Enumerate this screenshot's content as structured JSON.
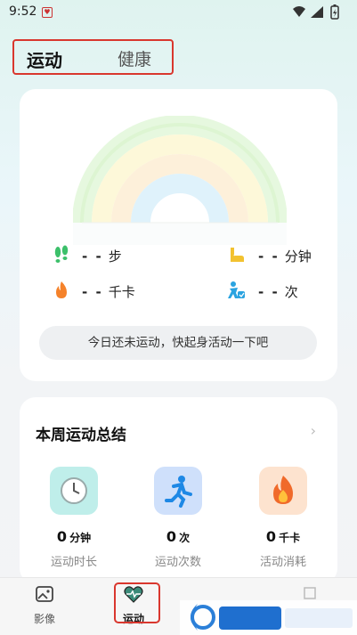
{
  "status_bar": {
    "time": "9:52",
    "notif_icon": "heart-notification-icon"
  },
  "top_tabs": {
    "active": "运动",
    "inactive": "健康"
  },
  "rainbow_card": {
    "steps": {
      "value": "- -",
      "unit": "步"
    },
    "minutes": {
      "value": "- -",
      "unit": "分钟"
    },
    "calories": {
      "value": "- -",
      "unit": "千卡"
    },
    "times": {
      "value": "- -",
      "unit": "次"
    },
    "hint": "今日还未运动，快起身活动一下吧"
  },
  "summary": {
    "title": "本周运动总结",
    "metrics": [
      {
        "value": "0",
        "unit": "分钟",
        "label": "运动时长",
        "icon": "clock-icon",
        "bg": "#bfeeea"
      },
      {
        "value": "0",
        "unit": "次",
        "label": "运动次数",
        "icon": "running-icon",
        "bg": "#cfe0fb"
      },
      {
        "value": "0",
        "unit": "千卡",
        "label": "活动消耗",
        "icon": "flame-icon",
        "bg": "#fde3cf"
      }
    ]
  },
  "bottom_nav": {
    "items": [
      {
        "label": "影像"
      },
      {
        "label": "运动"
      }
    ]
  },
  "colors": {
    "highlight": "#d9372e"
  }
}
